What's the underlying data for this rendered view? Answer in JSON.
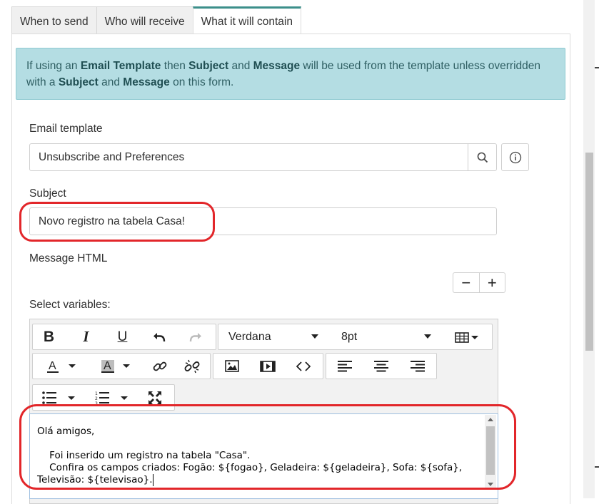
{
  "tabs": [
    {
      "label": "When to send"
    },
    {
      "label": "Who will receive"
    },
    {
      "label": "What it will contain"
    }
  ],
  "info": {
    "p1": "If using an ",
    "b1": "Email Template",
    "p2": " then ",
    "b2": "Subject",
    "p3": " and ",
    "b3": "Message",
    "p4": " will be used from the template unless overridden with a ",
    "b4": "Subject",
    "p5": " and ",
    "b5": "Message",
    "p6": " on this form."
  },
  "email_template": {
    "label": "Email template",
    "value": "Unsubscribe and Preferences"
  },
  "subject": {
    "label": "Subject",
    "value": "Novo registro na tabela Casa!"
  },
  "message_html": {
    "label": "Message HTML",
    "minus": "−",
    "plus": "+"
  },
  "select_variables": {
    "label": "Select variables:"
  },
  "toolbar": {
    "font_family": "Verdana",
    "font_size": "8pt",
    "bold": "B",
    "italic": "I",
    "underline": "U"
  },
  "editor_content": {
    "line1": "Olá amigos,",
    "line2": "",
    "line3": "    Foi inserido um registro na tabela \"Casa\".",
    "line4": "    Confira os campos criados: Fogão: ${fogao}, Geladeira: ${geladeira}, Sofa: ${sofa},",
    "line5": "Televisão: ${televisao}."
  },
  "colors": {
    "accent": "#3c8f8a",
    "info_bg": "#b4dde3",
    "highlight": "#e2262a"
  }
}
